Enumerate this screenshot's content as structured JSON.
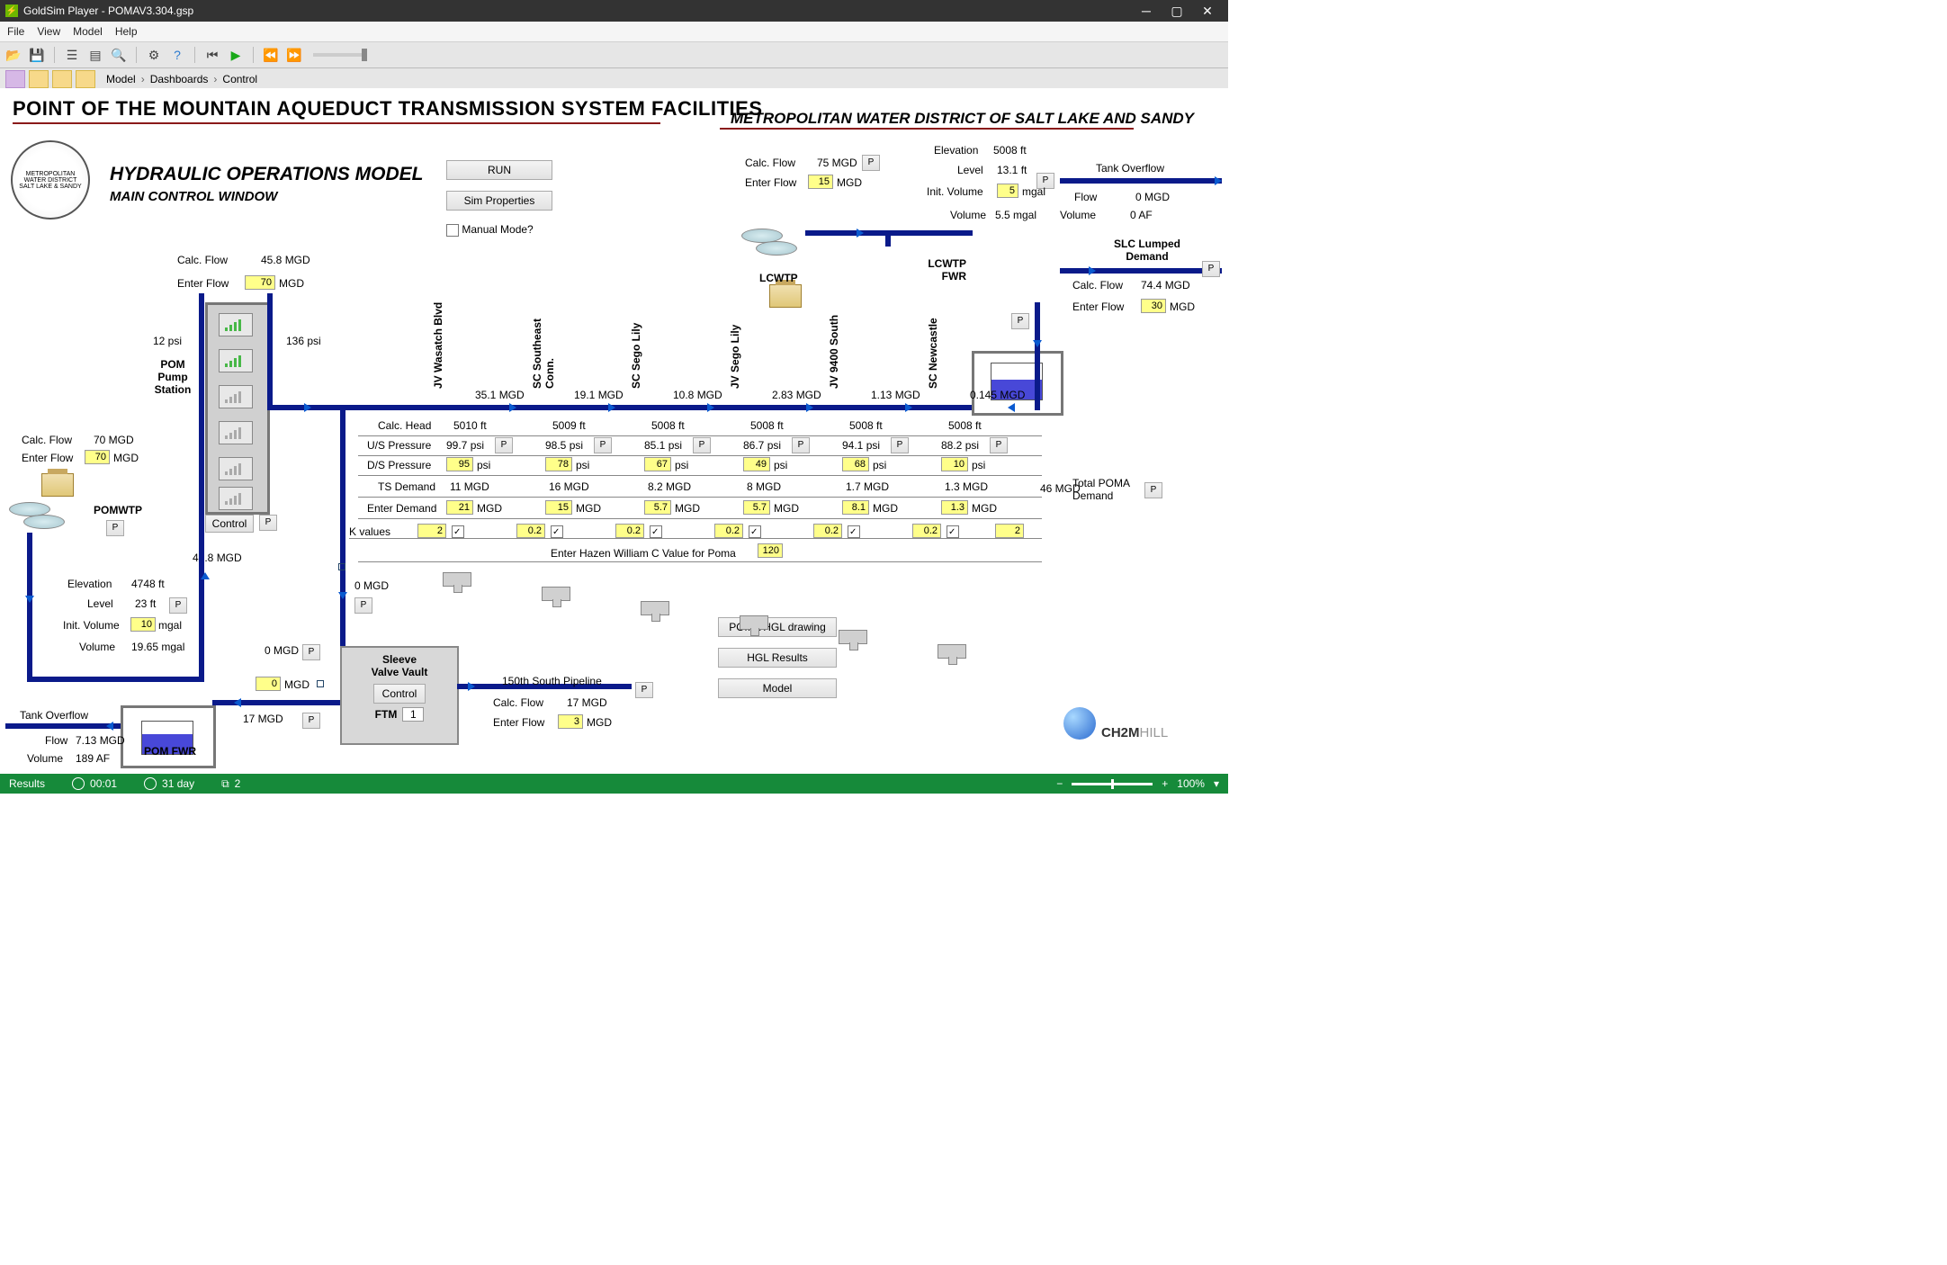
{
  "window": {
    "title": "GoldSim Player - POMAV3.304.gsp"
  },
  "menu": {
    "file": "File",
    "view": "View",
    "model": "Model",
    "help": "Help"
  },
  "breadcrumbs": {
    "a": "Model",
    "b": "Dashboards",
    "c": "Control"
  },
  "titles": {
    "main": "POINT OF THE MOUNTAIN AQUEDUCT TRANSMISSION SYSTEM FACILITIES",
    "district": "METROPOLITAN WATER DISTRICT OF SALT LAKE AND SANDY",
    "hom": "HYDRAULIC OPERATIONS MODEL",
    "hom_sub": "MAIN CONTROL WINDOW"
  },
  "buttons": {
    "run": "RUN",
    "simprops": "Sim Properties",
    "manual": "Manual Mode?",
    "control": "Control",
    "hgl_drawing": "POMA HGL drawing",
    "hgl_results": "HGL Results",
    "model": "Model"
  },
  "pom": {
    "pump_label": "POM\nPump\nStation",
    "psi_up": "12 psi",
    "psi_dn": "136 psi",
    "calc_flow_label": "Calc. Flow",
    "calc_flow_val": "45.8 MGD",
    "enter_flow_label": "Enter Flow",
    "enter_flow_in": "70",
    "enter_flow_unit": "MGD",
    "below_val": "45.8 MGD"
  },
  "pomwtp": {
    "label": "POMWTP",
    "calc_flow": "70 MGD",
    "enter_flow": "70"
  },
  "pom_tank": {
    "elev_label": "Elevation",
    "elev": "4748 ft",
    "level_label": "Level",
    "level": "23 ft",
    "initv_label": "Init. Volume",
    "initv": "10",
    "initv_unit": "mgal",
    "vol_label": "Volume",
    "vol": "19.65 mgal",
    "tank_overflow": "Tank Overflow",
    "flow_label": "Flow",
    "flow": "7.13 MGD",
    "volume_af_label": "Volume",
    "volume_af": "189 AF",
    "name": "POM FWR"
  },
  "sleeve": {
    "title1": "Sleeve",
    "title2": "Valve Vault",
    "ftm_label": "FTM",
    "ftm_val": "1",
    "zero_flow": "0 MGD",
    "in0": "0",
    "in0_unit": "MGD",
    "seventeen": "17 MGD"
  },
  "pipeline150": {
    "name": "150th South Pipeline",
    "calc_flow": "17 MGD",
    "enter_flow": "3"
  },
  "lcwtp": {
    "label": "LCWTP",
    "calc_flow": "75 MGD",
    "enter_flow": "15"
  },
  "lcwtp_tank": {
    "name": "LCWTP\nFWR",
    "elev_label": "Elevation",
    "elev": "5008 ft",
    "level_label": "Level",
    "level": "13.1 ft",
    "initv_label": "Init. Volume",
    "initv": "5",
    "initv_unit": "mgal",
    "vol_label": "Volume",
    "vol": "5.5 mgal",
    "tank_overflow": "Tank Overflow",
    "flow_label": "Flow",
    "flow": "0 MGD",
    "volume_af_label": "Volume",
    "volume_af": "0 AF"
  },
  "slc": {
    "title": "SLC Lumped\nDemand",
    "calc_flow": "74.4 MGD",
    "enter_flow": "30"
  },
  "joints": [
    {
      "name": "JV Wasatch Blvd",
      "flow": "35.1 MGD",
      "head": "5010 ft",
      "us_psi": "99.7 psi",
      "ds_psi": "95",
      "ts": "11 MGD",
      "demand": "21",
      "k": "2"
    },
    {
      "name": "SC Southeast Conn.",
      "flow": "19.1 MGD",
      "head": "5009 ft",
      "us_psi": "98.5 psi",
      "ds_psi": "78",
      "ts": "16 MGD",
      "demand": "15",
      "k": "0.2"
    },
    {
      "name": "SC Sego Lily",
      "flow": "10.8 MGD",
      "head": "5008 ft",
      "us_psi": "85.1 psi",
      "ds_psi": "67",
      "ts": "8.2 MGD",
      "demand": "5.7",
      "k": "0.2"
    },
    {
      "name": "JV Sego Lily",
      "flow": "2.83 MGD",
      "head": "5008 ft",
      "us_psi": "86.7 psi",
      "ds_psi": "49",
      "ts": "8 MGD",
      "demand": "5.7",
      "k": "0.2"
    },
    {
      "name": "JV 9400 South",
      "flow": "1.13 MGD",
      "head": "5008 ft",
      "us_psi": "94.1 psi",
      "ds_psi": "68",
      "ts": "1.7 MGD",
      "demand": "8.1",
      "k": "0.2"
    },
    {
      "name": "SC Newcastle",
      "flow": "0.145 MGD",
      "head": "5008 ft",
      "us_psi": "88.2 psi",
      "ds_psi": "10",
      "ts": "1.3 MGD",
      "demand": "1.3",
      "k": "0.2"
    }
  ],
  "k_last": "2",
  "table_labels": {
    "head": "Calc. Head",
    "us": "U/S Pressure",
    "ds": "D/S Pressure",
    "ts": "TS Demand",
    "enter": "Enter Demand",
    "k": "K values"
  },
  "total_poma": {
    "label": "Total POMA\nDemand",
    "val": "46 MGD"
  },
  "hazen": {
    "label": "Enter Hazen William C Value for Poma",
    "val": "120"
  },
  "zero_mgd": "0 MGD",
  "status": {
    "results": "Results",
    "time": "00:01",
    "days": "31 day",
    "docs": "2",
    "zoom": "100%"
  },
  "logo": {
    "a": "CH2M",
    "b": "HILL"
  },
  "generic": {
    "calc_flow": "Calc. Flow",
    "enter_flow": "Enter Flow",
    "mgd": "MGD",
    "psi": "psi"
  }
}
